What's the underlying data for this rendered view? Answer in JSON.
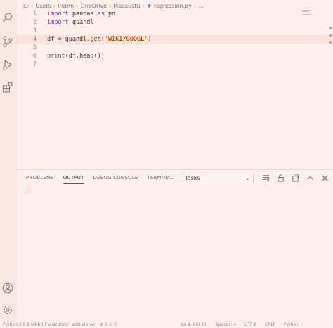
{
  "breadcrumb": {
    "items": [
      "C:",
      "Users",
      "iremn",
      "OneDrive",
      "Masaüstü",
      "regression.py",
      "..."
    ],
    "file_icon": "python-file-icon"
  },
  "editor": {
    "lines": [
      {
        "num": "1",
        "tokens": [
          {
            "t": "import",
            "c": "kw"
          },
          {
            "t": " pandas ",
            "c": ""
          },
          {
            "t": "as",
            "c": "kw"
          },
          {
            "t": " pd",
            "c": ""
          }
        ]
      },
      {
        "num": "2",
        "tokens": [
          {
            "t": "import",
            "c": "kw"
          },
          {
            "t": " quandl",
            "c": ""
          }
        ]
      },
      {
        "num": "3",
        "tokens": []
      },
      {
        "num": "4",
        "tokens": [
          {
            "t": "df = quandl.",
            "c": ""
          },
          {
            "t": "get",
            "c": "fn"
          },
          {
            "t": "(",
            "c": ""
          },
          {
            "t": "'WIKI/GOOGL'",
            "c": "str"
          },
          {
            "t": ")",
            "c": ""
          }
        ]
      },
      {
        "num": "5",
        "tokens": []
      },
      {
        "num": "6",
        "tokens": [
          {
            "t": "print",
            "c": "fn"
          },
          {
            "t": "(df.head())",
            "c": ""
          }
        ]
      },
      {
        "num": "7",
        "tokens": []
      }
    ],
    "current_line": 4
  },
  "panel": {
    "tabs": [
      "PROBLEMS",
      "OUTPUT",
      "DEBUG CONSOLE",
      "TERMINAL"
    ],
    "active_tab": "OUTPUT",
    "dropdown_value": "Tasks"
  },
  "activity_bar": {
    "icons": [
      "explorer-icon",
      "search-icon",
      "source-control-icon",
      "run-debug-icon",
      "extensions-icon",
      "account-icon",
      "settings-gear-icon"
    ]
  },
  "statusbar": {
    "left": "Python 3.8.2 64-bit ('anaconda': virtualenv)",
    "problems": "⊗ 0 ⚠ 0",
    "position": "Ln 4, Col 20",
    "spaces": "Spaces: 4",
    "encoding": "UTF-8",
    "eol": "CRLF",
    "language": "Python"
  },
  "colors": {
    "background": "#fdf0ec",
    "keyword": "#8a2aa8",
    "string": "#a3151a"
  }
}
